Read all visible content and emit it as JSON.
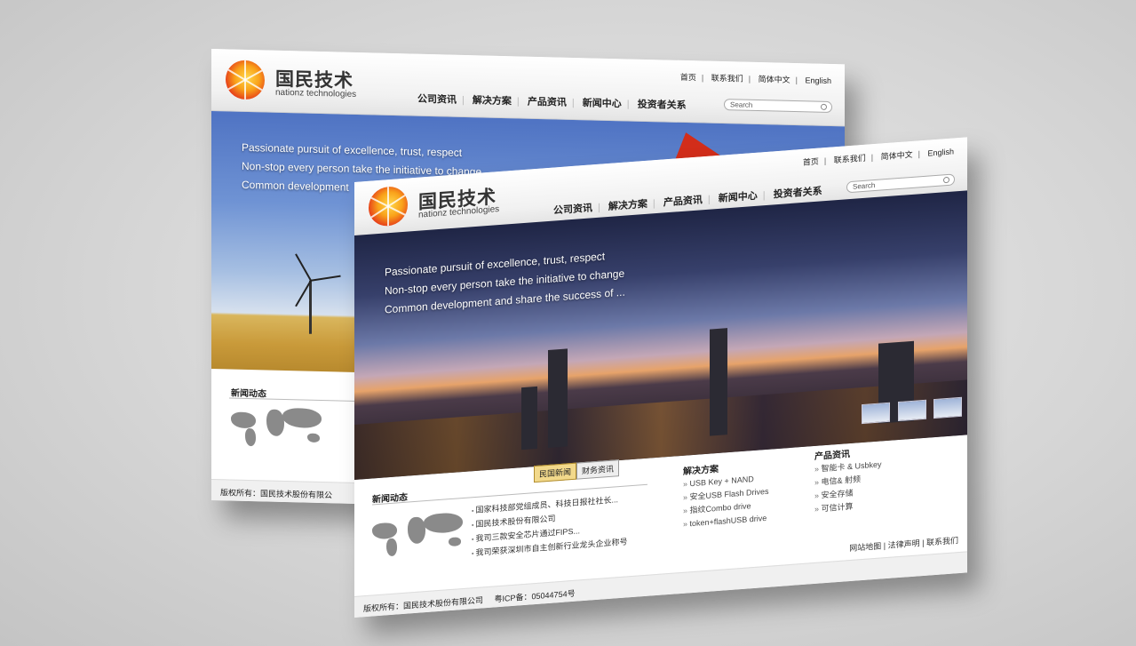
{
  "brand": {
    "name_cn": "国民技术",
    "name_en": "nationz technologies"
  },
  "toplinks": [
    "首页",
    "联系我们",
    "简体中文",
    "English"
  ],
  "nav": [
    "公司资讯",
    "解决方案",
    "产品资讯",
    "新闻中心",
    "投资者关系"
  ],
  "search": {
    "placeholder": "Search"
  },
  "slogan": [
    "Passionate pursuit of excellence, trust, respect",
    "Non-stop every person take the initiative to change",
    "Common development and share the success of ..."
  ],
  "back_slogan_line3": "Common development",
  "news": {
    "title": "新闻动态",
    "tabs": [
      "民国新闻",
      "财务资讯"
    ],
    "items": [
      "国家科技部党组成员、科技日报社社长...",
      "国民技术股份有限公司",
      "我司三款安全芯片通过FIPS...",
      "我司荣获深圳市自主创新行业龙头企业称号"
    ]
  },
  "solutions": {
    "title": "解决方案",
    "items": [
      "USB Key + NAND",
      "安全USB Flash Drives",
      "指纹Combo drive",
      "token+flashUSB drive"
    ]
  },
  "products": {
    "title": "产品资讯",
    "items": [
      "智能卡 & Usbkey",
      "电信& 射频",
      "安全存储",
      "可信计算"
    ]
  },
  "footer": {
    "copyright": "版权所有：国民技术股份有限公司",
    "icp": "粤ICP备：05044754号",
    "links": [
      "网站地图",
      "法律声明",
      "联系我们"
    ]
  },
  "back_footer": "版权所有：国民技术股份有限公"
}
